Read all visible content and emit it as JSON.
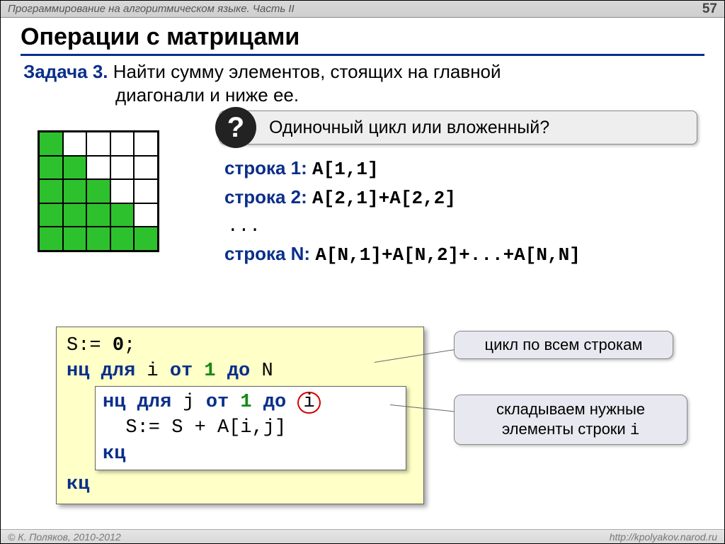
{
  "header": {
    "breadcrumb": "Программирование на алгоритмическом языке. Часть II",
    "page": "57"
  },
  "footer": {
    "copyright": "© К. Поляков, 2010-2012",
    "url": "http://kpolyakov.narod.ru"
  },
  "title": "Операции с матрицами",
  "task": {
    "label": "Задача 3.",
    "text_line1": "Найти сумму элементов, стоящих  на главной",
    "text_line2": "диагонали и ниже ее."
  },
  "question": {
    "glyph": "?",
    "text": "Одиночный цикл или вложенный?"
  },
  "matrix_pattern": [
    [
      1,
      0,
      0,
      0,
      0
    ],
    [
      1,
      1,
      0,
      0,
      0
    ],
    [
      1,
      1,
      1,
      0,
      0
    ],
    [
      1,
      1,
      1,
      1,
      0
    ],
    [
      1,
      1,
      1,
      1,
      1
    ]
  ],
  "rows": {
    "r1": {
      "label": "строка 1:",
      "expr": "A[1,1]"
    },
    "r2": {
      "label": "строка 2:",
      "expr": "A[2,1]+A[2,2]"
    },
    "ellipsis": "...",
    "rn": {
      "label": "строка N:",
      "expr": "A[N,1]+A[N,2]+...+A[N,N]"
    }
  },
  "code": {
    "l1a": "S:= ",
    "l1b": "0",
    "l1c": ";",
    "l2a": "нц для",
    "l2b": " i ",
    "l2c": "от",
    "l2d": " 1 ",
    "l2e": "до",
    "l2f": " N",
    "inner1a": "нц для",
    "inner1b": " j ",
    "inner1c": "от",
    "inner1d": " 1 ",
    "inner1e": "до ",
    "inner1f": "i",
    "inner2": "  S:= S + A[i,j]",
    "inner3": "кц",
    "l5": "кц"
  },
  "callouts": {
    "c1": "цикл по всем строкам",
    "c2a": "складываем нужные",
    "c2b": "элементы строки ",
    "c2c": "i"
  }
}
